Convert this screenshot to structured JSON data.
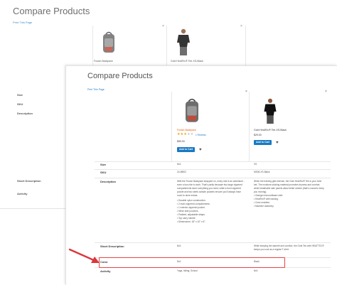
{
  "back": {
    "title": "Compare Products",
    "print_link": "Print This Page",
    "products": [
      {
        "name": "Fusion Backpack"
      },
      {
        "name": "Gobi HeatTec® Tee-XS-Black"
      }
    ],
    "row_labels": [
      "Size",
      "SKU",
      "Description",
      "Short Description",
      "Activity"
    ]
  },
  "front": {
    "title": "Compare Products",
    "print_link": "Print This Page",
    "products": [
      {
        "name": "Fusion Backpack",
        "rating": 3,
        "rating_max": 5,
        "reviews_text": "1 Reviews",
        "price": "$59.00",
        "add_to_cart": "Add to Cart",
        "name_color": "#eb5202"
      },
      {
        "name": "Gobi HeatTec® Tee-XS-Black",
        "price": "$29.00",
        "add_to_cart": "Add to Cart",
        "name_color": "#333333"
      }
    ],
    "rows": {
      "size": {
        "label": "Size",
        "values": [
          "N/A",
          "XS"
        ]
      },
      "sku": {
        "label": "SKU",
        "values": [
          "24-MB02",
          "MS06-XS-Black"
        ]
      },
      "description": {
        "label": "Description",
        "p1_text": "With the Fusion Backpack strapped on, every ride is an adventure - even a bus ride to work. That's partly because two large zippered compartments store everything you need, while a front zippered pocket and two sleek outside pockets ensure you'll always have room to store extras.",
        "p1_bullets": [
          "Durable nylon construction.",
          "2 main zippered compartments.",
          "1 exterior zippered pocket.",
          "Mesh side pouches.",
          "Padded, adjustable straps.",
          "Top carry handle.",
          "Dimensions: 18\" x 10\" x 6\"."
        ],
        "p2_text": "When the training gets intense, the Gobi HeatTec® Tee is your best bet. The moisture-wicking material promotes dryness and comfort, while breathable side panels allow better stretch (that's crucial to keep you moving).",
        "p2_bullets": [
          "Orange microsoftware shirt.",
          "HeatTec® with wicking.",
          "Crew neckline.",
          "Machine wash/dry."
        ]
      },
      "short_description": {
        "label": "Short Description",
        "values": [
          "N/A",
          "While keeping the warmth and comfort, the Gobi Tee with HEATTEC® keeps you cool as a regular T-shirt."
        ]
      },
      "color": {
        "label": "Color",
        "values": [
          "N/A",
          "Black"
        ]
      },
      "activity": {
        "label": "Activity",
        "values": [
          "Yoga, hiking, School",
          "N/A"
        ]
      }
    }
  },
  "colors": {
    "accent": "#1979c3",
    "highlight_border": "#e84545",
    "arrow": "#d9373d",
    "star": "#f2a21b"
  }
}
